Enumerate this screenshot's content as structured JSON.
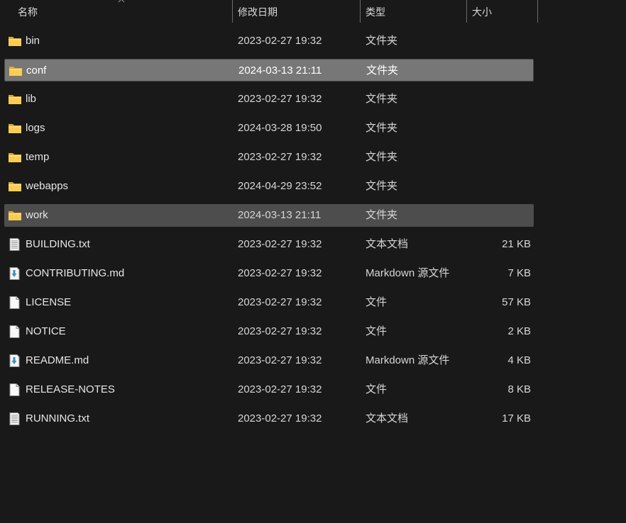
{
  "columns": {
    "name": "名称",
    "date": "修改日期",
    "type": "类型",
    "size": "大小"
  },
  "sort_indicator": "chevron-up",
  "colors": {
    "background": "#191919",
    "selected_row": "#777777",
    "hover_row": "#4d4d4d",
    "folder": "#f5c443",
    "md_arrow": "#3b8ec4"
  },
  "files": [
    {
      "name": "bin",
      "date": "2023-02-27 19:32",
      "type": "文件夹",
      "size": "",
      "icon": "folder",
      "state": ""
    },
    {
      "name": "conf",
      "date": "2024-03-13 21:11",
      "type": "文件夹",
      "size": "",
      "icon": "folder",
      "state": "selected"
    },
    {
      "name": "lib",
      "date": "2023-02-27 19:32",
      "type": "文件夹",
      "size": "",
      "icon": "folder",
      "state": ""
    },
    {
      "name": "logs",
      "date": "2024-03-28 19:50",
      "type": "文件夹",
      "size": "",
      "icon": "folder",
      "state": ""
    },
    {
      "name": "temp",
      "date": "2023-02-27 19:32",
      "type": "文件夹",
      "size": "",
      "icon": "folder",
      "state": ""
    },
    {
      "name": "webapps",
      "date": "2024-04-29 23:52",
      "type": "文件夹",
      "size": "",
      "icon": "folder",
      "state": ""
    },
    {
      "name": "work",
      "date": "2024-03-13 21:11",
      "type": "文件夹",
      "size": "",
      "icon": "folder",
      "state": "hover"
    },
    {
      "name": "BUILDING.txt",
      "date": "2023-02-27 19:32",
      "type": "文本文档",
      "size": "21 KB",
      "icon": "text",
      "state": ""
    },
    {
      "name": "CONTRIBUTING.md",
      "date": "2023-02-27 19:32",
      "type": "Markdown 源文件",
      "size": "7 KB",
      "icon": "markdown",
      "state": ""
    },
    {
      "name": "LICENSE",
      "date": "2023-02-27 19:32",
      "type": "文件",
      "size": "57 KB",
      "icon": "file",
      "state": ""
    },
    {
      "name": "NOTICE",
      "date": "2023-02-27 19:32",
      "type": "文件",
      "size": "2 KB",
      "icon": "file",
      "state": ""
    },
    {
      "name": "README.md",
      "date": "2023-02-27 19:32",
      "type": "Markdown 源文件",
      "size": "4 KB",
      "icon": "markdown",
      "state": ""
    },
    {
      "name": "RELEASE-NOTES",
      "date": "2023-02-27 19:32",
      "type": "文件",
      "size": "8 KB",
      "icon": "file",
      "state": ""
    },
    {
      "name": "RUNNING.txt",
      "date": "2023-02-27 19:32",
      "type": "文本文档",
      "size": "17 KB",
      "icon": "text",
      "state": ""
    }
  ]
}
